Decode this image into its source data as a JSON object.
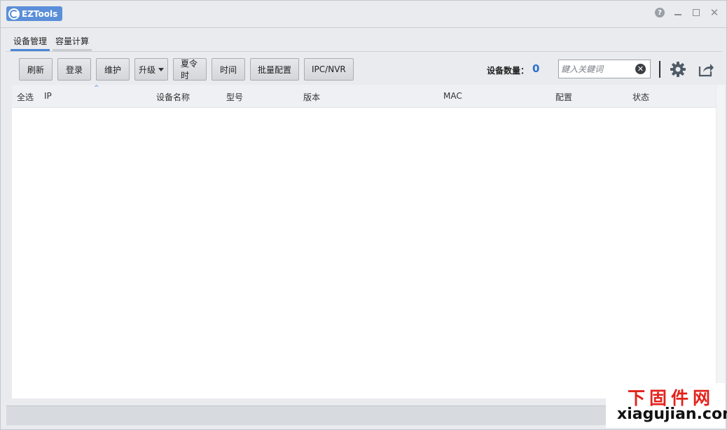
{
  "app": {
    "title": "EZTools"
  },
  "window_controls": {
    "help": "?",
    "minimize": "",
    "maximize": "",
    "close": "✕"
  },
  "tabs": [
    {
      "label": "设备管理",
      "active": true
    },
    {
      "label": "容量计算",
      "active": false
    }
  ],
  "toolbar": {
    "refresh": "刷新",
    "login": "登录",
    "maintain": "维护",
    "upgrade": "升级",
    "dst": "夏令时",
    "time": "时间",
    "batch_config": "批量配置",
    "ipc_nvr": "IPC/NVR"
  },
  "device_count": {
    "label": "设备数量：",
    "value": "0"
  },
  "search": {
    "placeholder": "鍵入关鍵词",
    "value": ""
  },
  "icons": {
    "clear": "close-circle-icon",
    "settings": "gear-icon",
    "export": "share-icon"
  },
  "table": {
    "columns": [
      "全选",
      "IP",
      "设备名称",
      "型号",
      "版本",
      "MAC",
      "配置",
      "状态"
    ],
    "rows": []
  },
  "watermark": {
    "cn": "下固件网",
    "en": "xiagujian.com"
  }
}
